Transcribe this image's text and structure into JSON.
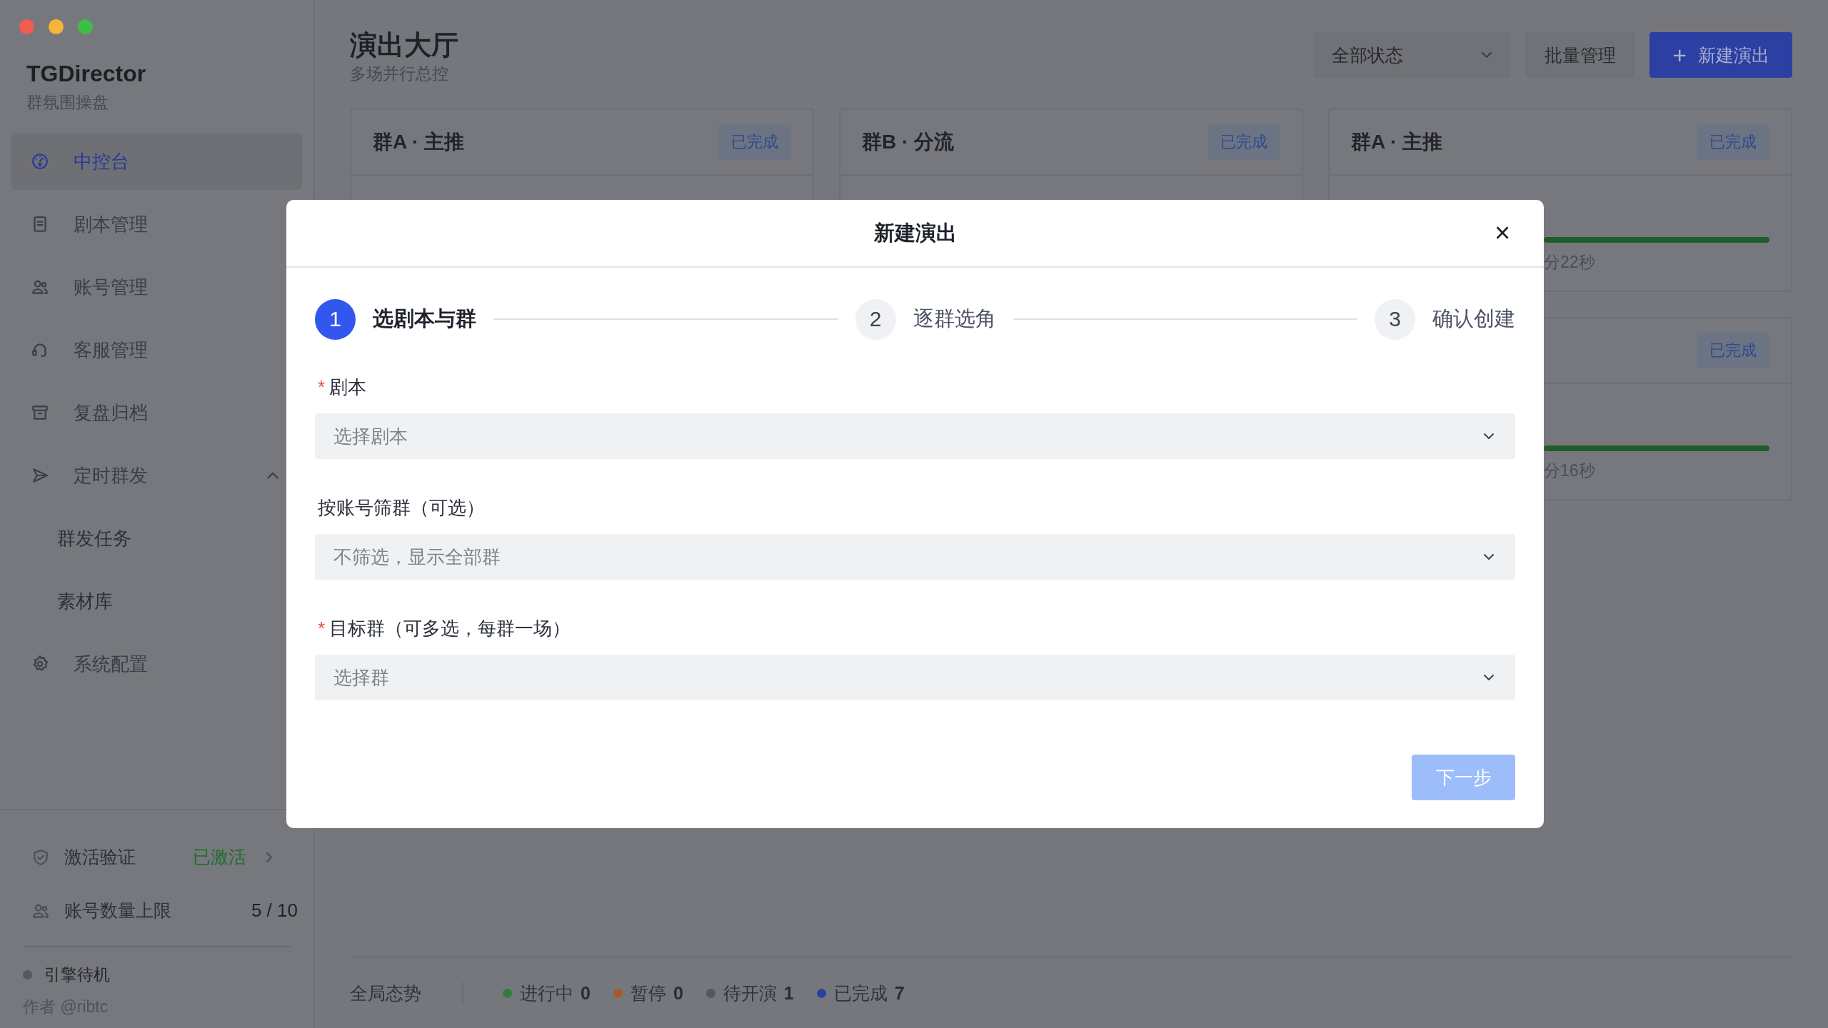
{
  "sidebar": {
    "brand": "TGDirector",
    "subtitle": "群氛围操盘",
    "nav": [
      {
        "label": "中控台",
        "selected": true
      },
      {
        "label": "剧本管理",
        "selected": false
      },
      {
        "label": "账号管理",
        "selected": false
      },
      {
        "label": "客服管理",
        "selected": false
      },
      {
        "label": "复盘归档",
        "selected": false
      },
      {
        "label": "定时群发",
        "selected": false,
        "expanded": true,
        "children": [
          {
            "label": "群发任务"
          },
          {
            "label": "素材库"
          }
        ]
      },
      {
        "label": "系统配置",
        "selected": false
      }
    ],
    "activation": {
      "label": "激活验证",
      "status": "已激活"
    },
    "quota": {
      "label": "账号数量上限",
      "value": "5 / 10"
    },
    "engine": {
      "label": "引擎待机",
      "color": "#55575d"
    },
    "author": "作者 @ribtc"
  },
  "main": {
    "title": "演出大厅",
    "subtitle": "多场并行总控",
    "filter": {
      "value": "全部状态"
    },
    "batch_button": "批量管理",
    "create_button": {
      "icon": "+",
      "label": "新建演出"
    },
    "card_columns": [
      [
        {
          "title": "群A · 主推",
          "status": "已完成"
        }
      ],
      [
        {
          "title": "群B · 分流",
          "status": "已完成"
        }
      ],
      [
        {
          "title": "群A · 主推",
          "status": "已完成",
          "level": 1,
          "elapsed": "分22秒"
        },
        {
          "status": "已完成",
          "level": 1,
          "elapsed": "分16秒"
        }
      ]
    ],
    "status_bar": {
      "label": "全局态势",
      "items": [
        {
          "label": "进行中",
          "count": "0",
          "color": "#2f7d3a"
        },
        {
          "label": "暂停",
          "count": "0",
          "color": "#a8582c"
        },
        {
          "label": "待开演",
          "count": "1",
          "color": "#55575d"
        },
        {
          "label": "已完成",
          "count": "7",
          "color": "#2c3f9e"
        }
      ]
    }
  },
  "modal": {
    "title": "新建演出",
    "close": "×",
    "steps": [
      {
        "number": "1",
        "label": "选剧本与群",
        "selected": true
      },
      {
        "number": "2",
        "label": "逐群选角",
        "selected": false
      },
      {
        "number": "3",
        "label": "确认创建",
        "selected": false
      }
    ],
    "fields": [
      {
        "label": "剧本",
        "required": true,
        "placeholder": "选择剧本"
      },
      {
        "label": "按账号筛群（可选）",
        "required": false,
        "placeholder": "不筛选，显示全部群"
      },
      {
        "label": "目标群（可多选，每群一场）",
        "required": true,
        "placeholder": "选择群"
      }
    ],
    "required_mark": "*",
    "next_button": {
      "label": "下一步",
      "disabled": true
    }
  }
}
